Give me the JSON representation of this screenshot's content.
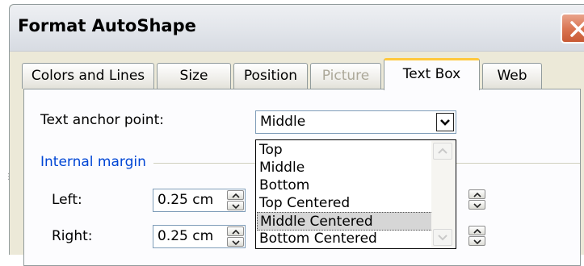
{
  "window": {
    "title": "Format AutoShape",
    "close_icon": "close-icon"
  },
  "tabs": [
    {
      "label": "Colors and Lines",
      "state": "normal"
    },
    {
      "label": "Size",
      "state": "normal"
    },
    {
      "label": "Position",
      "state": "normal"
    },
    {
      "label": "Picture",
      "state": "disabled"
    },
    {
      "label": "Text Box",
      "state": "active"
    },
    {
      "label": "Web",
      "state": "normal"
    }
  ],
  "text_box": {
    "anchor_label": "Text anchor point:",
    "anchor_value": "Middle",
    "anchor_options": [
      "Top",
      "Middle",
      "Bottom",
      "Top Centered",
      "Middle Centered",
      "Bottom Centered"
    ],
    "highlighted_option": "Middle Centered",
    "internal_margin_label": "Internal margin",
    "left_label": "Left:",
    "left_value": "0.25 cm",
    "right_label": "Right:",
    "right_value": "0.25 cm"
  },
  "colors": {
    "accent_tab": "#ffc83c",
    "group_label": "#0046d5",
    "close_button": "#d9734f"
  }
}
